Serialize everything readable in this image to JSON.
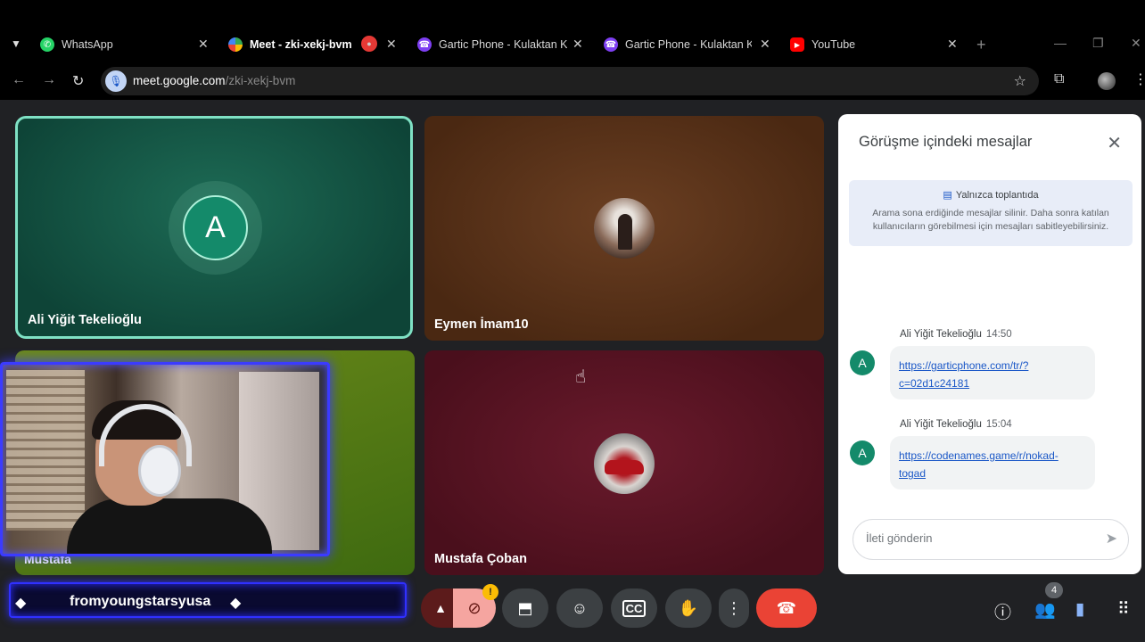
{
  "browser": {
    "tabs": [
      {
        "title": "WhatsApp",
        "active": false
      },
      {
        "title": "Meet - zki-xekj-bvm",
        "active": true
      },
      {
        "title": "",
        "active": false
      },
      {
        "title": "Gartic Phone - Kulaktan Kulağa",
        "active": false
      },
      {
        "title": "Gartic Phone - Kulaktan Kulağa",
        "active": false
      },
      {
        "title": "YouTube",
        "active": false
      }
    ],
    "url_host": "meet.google.com",
    "url_path": "/zki-xekj-bvm"
  },
  "meet": {
    "participants": [
      {
        "name": "Ali Yiğit Tekelioğlu",
        "initial": "A",
        "speaking": true
      },
      {
        "name": "Eymen İmam10"
      },
      {
        "name": "Mustafa"
      },
      {
        "name": "Mustafa Çoban"
      }
    ],
    "chat": {
      "title": "Görüşme içindeki mesajlar",
      "notice_title": "Yalnızca toplantıda",
      "notice_body": "Arama sona erdiğinde mesajlar silinir. Daha sonra katılan kullanıcıların görebilmesi için mesajları sabitleyebilirsiniz.",
      "messages": [
        {
          "sender": "Ali Yiğit Tekelioğlu",
          "time": "14:50",
          "initial": "A",
          "line1": "https://garticphone.com/tr/?",
          "line2": "c=02d1c24181"
        },
        {
          "sender": "Ali Yiğit Tekelioğlu",
          "time": "15:04",
          "initial": "A",
          "line1": "https://codenames.game/r/nokad-",
          "line2": "togad"
        }
      ],
      "input_placeholder": "İleti gönderin"
    },
    "controls": {
      "camera_warning": "!",
      "people_count": "4"
    }
  },
  "overlay": {
    "streamer_name": "fromyoungstarsyusa"
  },
  "colors": {
    "speaking_border": "#7fe1c4",
    "leave_button": "#ea4335",
    "link": "#1a57c7"
  }
}
